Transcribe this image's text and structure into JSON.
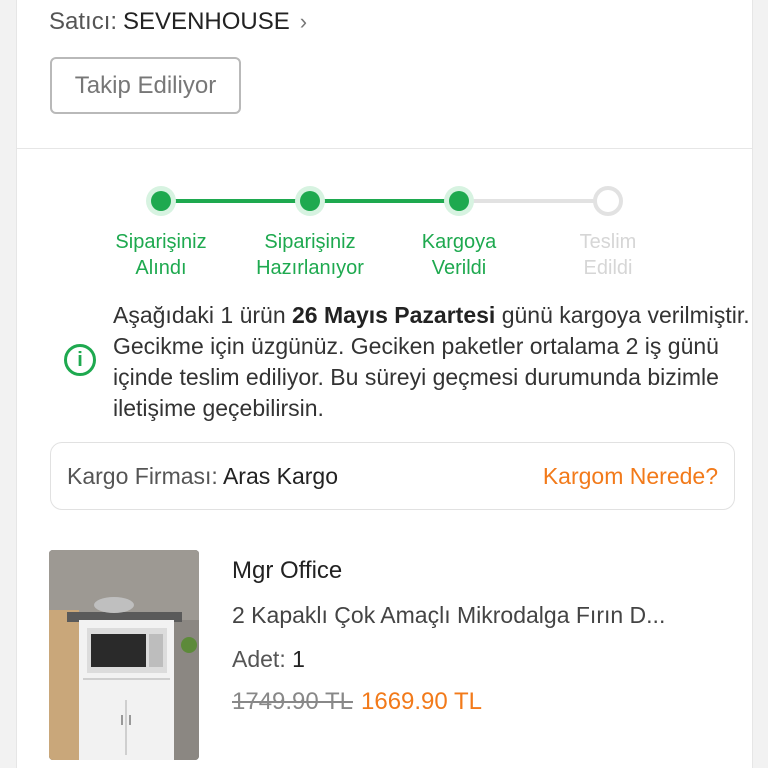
{
  "seller": {
    "label": "Satıcı:",
    "name": "SEVENHOUSE",
    "chevron": "›"
  },
  "follow_button": "Takip Ediliyor",
  "steps": [
    {
      "line1": "Siparişiniz",
      "line2": "Alındı",
      "status": "done"
    },
    {
      "line1": "Siparişiniz",
      "line2": "Hazırlanıyor",
      "status": "done"
    },
    {
      "line1": "Kargoya",
      "line2": "Verildi",
      "status": "done"
    },
    {
      "line1": "Teslim",
      "line2": "Edildi",
      "status": "todo"
    }
  ],
  "info": {
    "icon": "info-circle-icon",
    "text_before": "Aşağıdaki 1 ürün ",
    "bold_date": "26 Mayıs Pazartesi",
    "text_after": " günü kargoya verilmiştir. Gecikme için üzgünüz. Geciken paketler ortalama 2 iş günü içinde teslim ediliyor. Bu süreyi geçmesi durumunda bizimle iletişime geçebilirsin."
  },
  "cargo": {
    "label": "Kargo Firması:",
    "company": "Aras Kargo",
    "link": "Kargom Nerede?"
  },
  "product": {
    "brand": "Mgr Office",
    "name": "2 Kapaklı Çok Amaçlı Mikrodalga Fırın D...",
    "qty_label": "Adet:",
    "qty_value": "1",
    "old_price": "1749.90 TL",
    "new_price": "1669.90 TL"
  },
  "colors": {
    "green": "#1ea94f",
    "orange": "#f27a1a"
  }
}
